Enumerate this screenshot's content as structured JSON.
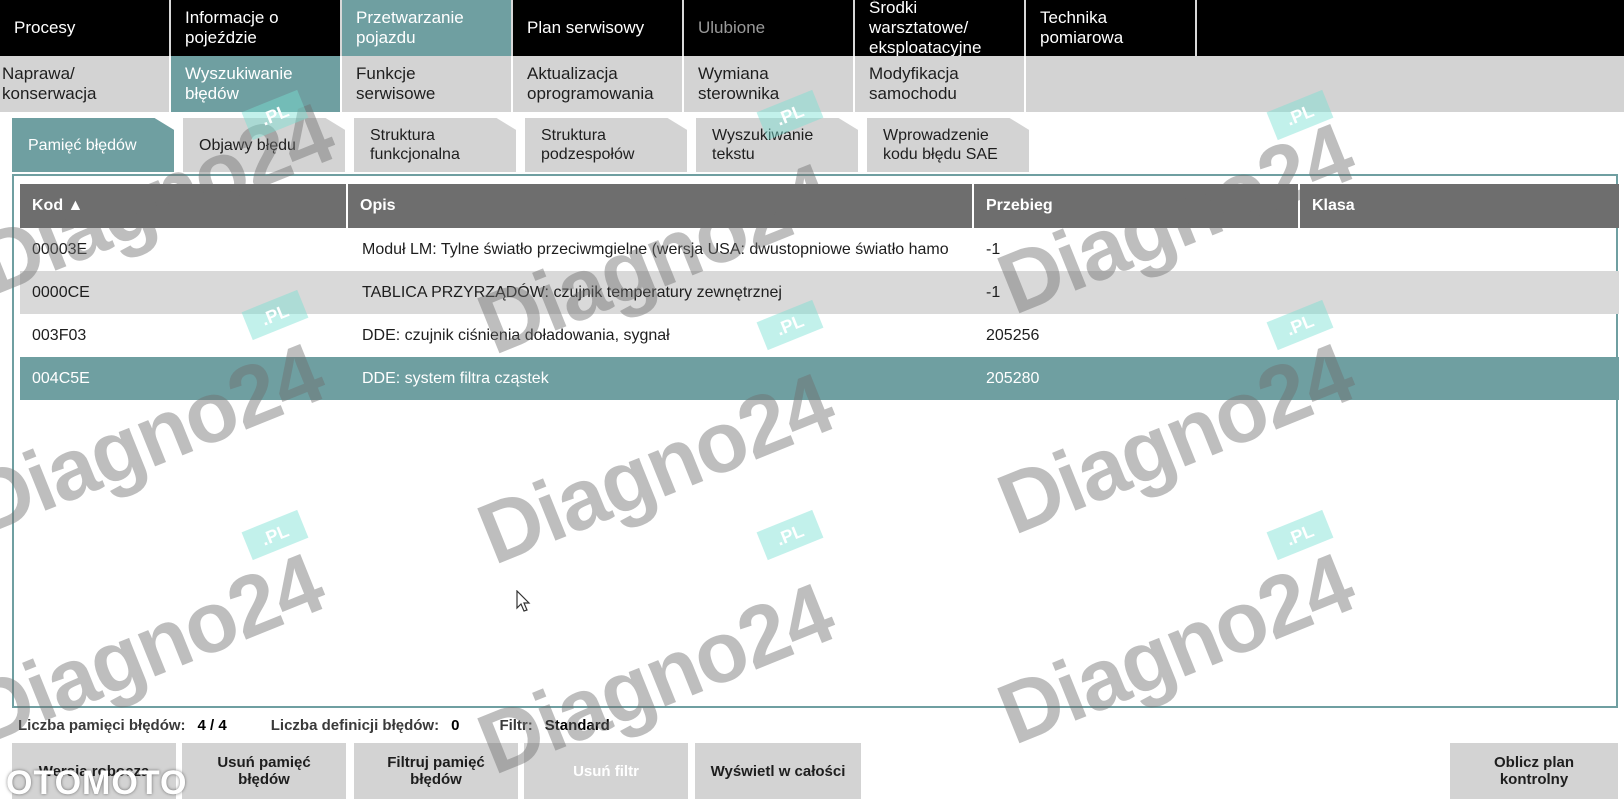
{
  "nav_row1": [
    {
      "label": "Procesy",
      "state": "normal"
    },
    {
      "label": "Informacje o pojeździe",
      "state": "normal"
    },
    {
      "label": "Przetwarzanie pojazdu",
      "state": "active"
    },
    {
      "label": "Plan serwisowy",
      "state": "normal"
    },
    {
      "label": "Ulubione",
      "state": "dim"
    },
    {
      "label": "Środki warsztatowe/ eksploatacyjne",
      "state": "normal"
    },
    {
      "label": "Technika pomiarowa",
      "state": "normal"
    }
  ],
  "nav_row2": [
    {
      "label": "Naprawa/ konserwacja",
      "state": "normal"
    },
    {
      "label": "Wyszukiwanie błędów",
      "state": "active"
    },
    {
      "label": "Funkcje serwisowe",
      "state": "normal"
    },
    {
      "label": "Aktualizacja oprogramowania",
      "state": "normal"
    },
    {
      "label": "Wymiana sterownika",
      "state": "normal"
    },
    {
      "label": "Modyfikacja samochodu",
      "state": "normal"
    }
  ],
  "sub_tabs": [
    {
      "label": "Pamięć błędów",
      "state": "active"
    },
    {
      "label": "Objawy błędu",
      "state": "normal"
    },
    {
      "label": "Struktura funkcjonalna",
      "state": "normal"
    },
    {
      "label": "Struktura podzespołów",
      "state": "normal"
    },
    {
      "label": "Wyszukiwanie tekstu",
      "state": "normal"
    },
    {
      "label": "Wprowadzenie kodu błędu SAE",
      "state": "normal"
    }
  ],
  "table": {
    "headers": [
      "Kod ▲",
      "Opis",
      "Przebieg",
      "Klasa"
    ],
    "rows": [
      {
        "kod": "00003E",
        "opis": "Moduł LM: Tylne światło przeciwmgielne (wersja USA: dwustopniowe światło hamo",
        "przebieg": "-1",
        "klasa": "",
        "selected": false
      },
      {
        "kod": "0000CE",
        "opis": "TABLICA PRZYRZĄDÓW: czujnik temperatury zewnętrznej",
        "przebieg": "-1",
        "klasa": "",
        "selected": false
      },
      {
        "kod": "003F03",
        "opis": "DDE: czujnik ciśnienia doładowania, sygnał",
        "przebieg": "205256",
        "klasa": "",
        "selected": false
      },
      {
        "kod": "004C5E",
        "opis": "DDE: system filtra cząstek",
        "przebieg": "205280",
        "klasa": "",
        "selected": true
      }
    ]
  },
  "status": {
    "count_label": "Liczba pamięci błędów:",
    "count_value": "4 / 4",
    "def_label": "Liczba definicji błędów:",
    "def_value": "0",
    "filter_label": "Filtr:",
    "filter_value": "Standard"
  },
  "buttons": {
    "btn1": "Wersja robocza",
    "btn2": "Usuń pamięć błędów",
    "btn3": "Filtruj pamięć błędów",
    "btn4": "Usuń filtr",
    "btn5": "Wyświetl w całości",
    "btn6": "Oblicz plan kontrolny"
  },
  "watermark": {
    "text": "Diagno24",
    "suffix": ".PL",
    "brand": "OTOMOTO"
  },
  "colors": {
    "accent": "#6f9fa1",
    "header": "#6e6e6e",
    "nav_bg": "#000000",
    "tab_bg": "#d3d3d3"
  }
}
